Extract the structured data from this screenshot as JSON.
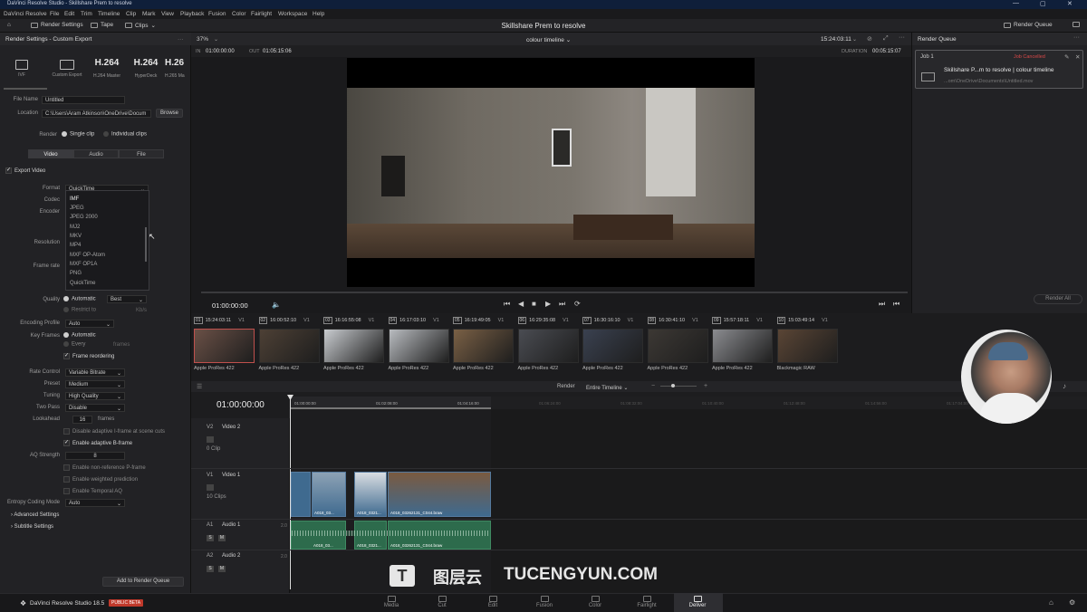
{
  "window": {
    "title": "DaVinci Resolve Studio - Skillshare Prem to resolve"
  },
  "menu": [
    "DaVinci Resolve",
    "File",
    "Edit",
    "Trim",
    "Timeline",
    "Clip",
    "Mark",
    "View",
    "Playback",
    "Fusion",
    "Color",
    "Fairlight",
    "Workspace",
    "Help"
  ],
  "toolbar": {
    "render_settings": "Render Settings",
    "tape": "Tape",
    "clips": "Clips",
    "project_title": "Skillshare Prem to resolve",
    "render_queue": "Render Queue"
  },
  "render_settings": {
    "header": "Render Settings - Custom Export",
    "presets": [
      {
        "big": "",
        "label": "IVF"
      },
      {
        "big": "",
        "label": "Custom Export"
      },
      {
        "big": "H.264",
        "label": "H.264 Master"
      },
      {
        "big": "H.264",
        "label": "HyperDeck"
      },
      {
        "big": "H.26",
        "label": "H.265 Ma"
      }
    ],
    "file_name_label": "File Name",
    "file_name": "Untitled",
    "location_label": "Location",
    "location": "C:\\Users\\Aram Atkinson\\OneDrive\\Docum",
    "browse": "Browse",
    "render_label": "Render",
    "single_clip": "Single clip",
    "individual_clips": "Individual clips",
    "tabs": [
      "Video",
      "Audio",
      "File"
    ],
    "export_video": "Export Video",
    "format_label": "Format",
    "format_value": "QuickTime",
    "codec_label": "Codec",
    "encoder_label": "Encoder",
    "resolution_label": "Resolution",
    "frame_rate_label": "Frame rate",
    "format_options": [
      "IMF",
      "JPEG",
      "JPEG 2000",
      "MJ2",
      "MKV",
      "MP4",
      "MXF OP-Atom",
      "MXF OP1A",
      "PNG",
      "QuickTime"
    ],
    "quality_label": "Quality",
    "quality_auto": "Automatic",
    "quality_best": "Best",
    "restrict_to": "Restrict to",
    "kbs": "Kb/s",
    "encoding_profile_label": "Encoding Profile",
    "encoding_profile": "Auto",
    "key_frames_label": "Key Frames",
    "kf_automatic": "Automatic",
    "kf_every": "Every",
    "kf_frames": "frames",
    "frame_reordering": "Frame reordering",
    "rate_control_label": "Rate Control",
    "rate_control": "Variable Bitrate",
    "preset_label": "Preset",
    "preset": "Medium",
    "tuning_label": "Tuning",
    "tuning": "High Quality",
    "two_pass_label": "Two Pass",
    "two_pass": "Disable",
    "lookahead_label": "Lookahead",
    "lookahead": "16",
    "lookahead_unit": "frames",
    "disable_iframe": "Disable adaptive I-frame at scene cuts",
    "enable_bframe": "Enable adaptive B-frame",
    "aq_strength_label": "AQ Strength",
    "aq_strength": "8",
    "non_ref_pframe": "Enable non-reference P-frame",
    "weighted_pred": "Enable weighted prediction",
    "temporal_aq": "Enable Temporal AQ",
    "entropy_label": "Entropy Coding Mode",
    "entropy": "Auto",
    "advanced": "Advanced Settings",
    "subtitle": "Subtitle Settings",
    "add_to_queue": "Add to Render Queue"
  },
  "viewer": {
    "zoom": "37%",
    "timeline_name": "colour timeline",
    "timecode": "15:24:03:11",
    "in_label": "IN",
    "in_tc": "01:00:00:00",
    "out_label": "OUT",
    "out_tc": "01:05:15:06",
    "duration_label": "DURATION",
    "duration": "00:05:15:07",
    "play_tc": "01:00:00:00"
  },
  "render_queue": {
    "title": "Render Queue",
    "job": "Job 1",
    "status": "Job Cancelled",
    "job_name": "Skillshare P...m to resolve | colour timeline",
    "job_path": "...om\\OneDrive\\Documents\\Untitled.mov",
    "render_all": "Render All"
  },
  "clips": [
    {
      "n": "01",
      "tc": "15:24:03:11",
      "track": "V1",
      "codec": "Apple ProRes 422"
    },
    {
      "n": "02",
      "tc": "16:00:52:10",
      "track": "V1",
      "codec": "Apple ProRes 422"
    },
    {
      "n": "03",
      "tc": "16:16:55:08",
      "track": "V1",
      "codec": "Apple ProRes 422"
    },
    {
      "n": "04",
      "tc": "16:17:03:10",
      "track": "V1",
      "codec": "Apple ProRes 422"
    },
    {
      "n": "05",
      "tc": "16:19:49:05",
      "track": "V1",
      "codec": "Apple ProRes 422"
    },
    {
      "n": "06",
      "tc": "16:29:35:08",
      "track": "V1",
      "codec": "Apple ProRes 422"
    },
    {
      "n": "07",
      "tc": "16:30:16:10",
      "track": "V1",
      "codec": "Apple ProRes 422"
    },
    {
      "n": "08",
      "tc": "16:30:41:10",
      "track": "V1",
      "codec": "Apple ProRes 422"
    },
    {
      "n": "09",
      "tc": "15:57:18:11",
      "track": "V1",
      "codec": "Apple ProRes 422"
    },
    {
      "n": "10",
      "tc": "15:03:49:14",
      "track": "V1",
      "codec": "Blackmagic RAW"
    }
  ],
  "timeline": {
    "render_label": "Render",
    "render_scope": "Entire Timeline",
    "timecode": "01:00:00:00",
    "ruler": [
      "01:00:00:00",
      "01:02:08:00",
      "01:04:16:00",
      "01:06:24:00",
      "01:08:32:00",
      "01:10:40:00",
      "01:12:48:00",
      "01:14:56:00",
      "01:17:04:00"
    ],
    "tracks": {
      "v2": {
        "id": "V2",
        "name": "Video 2",
        "clips": "0 Clip"
      },
      "v1": {
        "id": "V1",
        "name": "Video 1",
        "clips": "10 Clips"
      },
      "a1": {
        "id": "A1",
        "name": "Audio 1",
        "ch": "2.0"
      },
      "a2": {
        "id": "A2",
        "name": "Audio 2",
        "ch": "2.0"
      }
    },
    "clip_names": [
      "A018_03...",
      "A018_0321...",
      "A018_03262131_C044.braw"
    ]
  },
  "pages": [
    "Media",
    "Cut",
    "Edit",
    "Fusion",
    "Color",
    "Fairlight",
    "Deliver"
  ],
  "footer": {
    "app": "DaVinci Resolve Studio 18.5",
    "badge": "PUBLIC BETA"
  },
  "watermark": {
    "cn": "图层云",
    "en": "TUCENGYUN.COM"
  }
}
